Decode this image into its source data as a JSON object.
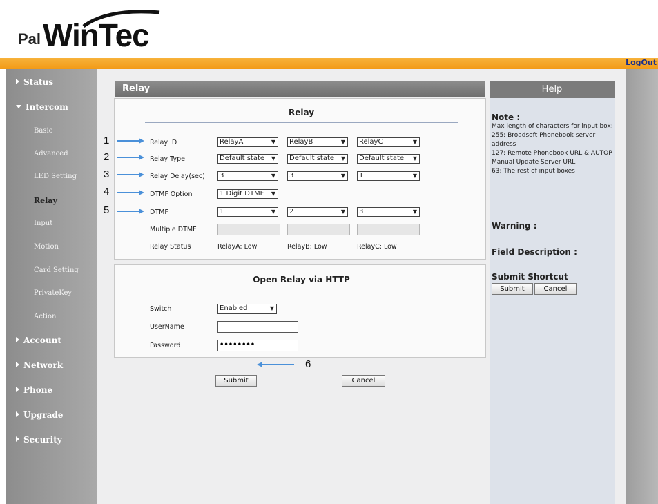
{
  "logo": {
    "prefix": "Pal",
    "name": "WinTec"
  },
  "header": {
    "logout": "LogOut"
  },
  "sidebar": {
    "items": [
      {
        "label": "Status"
      },
      {
        "label": "Intercom"
      },
      {
        "label": "Basic"
      },
      {
        "label": "Advanced"
      },
      {
        "label": "LED Setting"
      },
      {
        "label": "Relay"
      },
      {
        "label": "Input"
      },
      {
        "label": "Motion"
      },
      {
        "label": "Card Setting"
      },
      {
        "label": "PrivateKey"
      },
      {
        "label": "Action"
      },
      {
        "label": "Account"
      },
      {
        "label": "Network"
      },
      {
        "label": "Phone"
      },
      {
        "label": "Upgrade"
      },
      {
        "label": "Security"
      }
    ]
  },
  "page": {
    "title": "Relay"
  },
  "relay": {
    "section_title": "Relay",
    "labels": {
      "relay_id": "Relay ID",
      "relay_type": "Relay Type",
      "relay_delay": "Relay Delay(sec)",
      "dtmf_option": "DTMF Option",
      "dtmf": "DTMF",
      "multiple_dtmf": "Multiple DTMF",
      "relay_status": "Relay Status"
    },
    "relay_id": [
      "RelayA",
      "RelayB",
      "RelayC"
    ],
    "relay_type": [
      "Default state",
      "Default state",
      "Default state"
    ],
    "relay_delay": [
      "3",
      "3",
      "1"
    ],
    "dtmf_option": "1 Digit DTMF",
    "dtmf": [
      "1",
      "2",
      "3"
    ],
    "multiple_dtmf": [
      "",
      "",
      ""
    ],
    "status": [
      "RelayA: Low",
      "RelayB: Low",
      "RelayC: Low"
    ]
  },
  "http": {
    "section_title": "Open Relay via HTTP",
    "labels": {
      "switch": "Switch",
      "username": "UserName",
      "password": "Password"
    },
    "switch": "Enabled",
    "username": "",
    "password": "••••••••"
  },
  "actions": {
    "submit": "Submit",
    "cancel": "Cancel"
  },
  "annotations": [
    "1",
    "2",
    "3",
    "4",
    "5",
    "6"
  ],
  "help": {
    "title": "Help",
    "note_title": "Note :",
    "note_lines": [
      "Max length of characters for input box:",
      "255: Broadsoft Phonebook server address",
      "127: Remote Phonebook URL & AUTOP Manual Update Server URL",
      "63: The rest of input boxes"
    ],
    "warning_title": "Warning :",
    "field_desc_title": "Field Description :",
    "shortcut_title": "Submit Shortcut",
    "shortcut_submit": "Submit",
    "shortcut_cancel": "Cancel"
  },
  "colors": {
    "topbar": "#f29a16",
    "sidebar": "#9a9a9a",
    "header": "#7b7b7b",
    "arrow": "#4a90d9",
    "link": "#1a2e8a"
  },
  "icons": [
    "triangle-right-icon",
    "triangle-down-icon",
    "dropdown-arrow-icon",
    "annotation-arrow-icon"
  ]
}
